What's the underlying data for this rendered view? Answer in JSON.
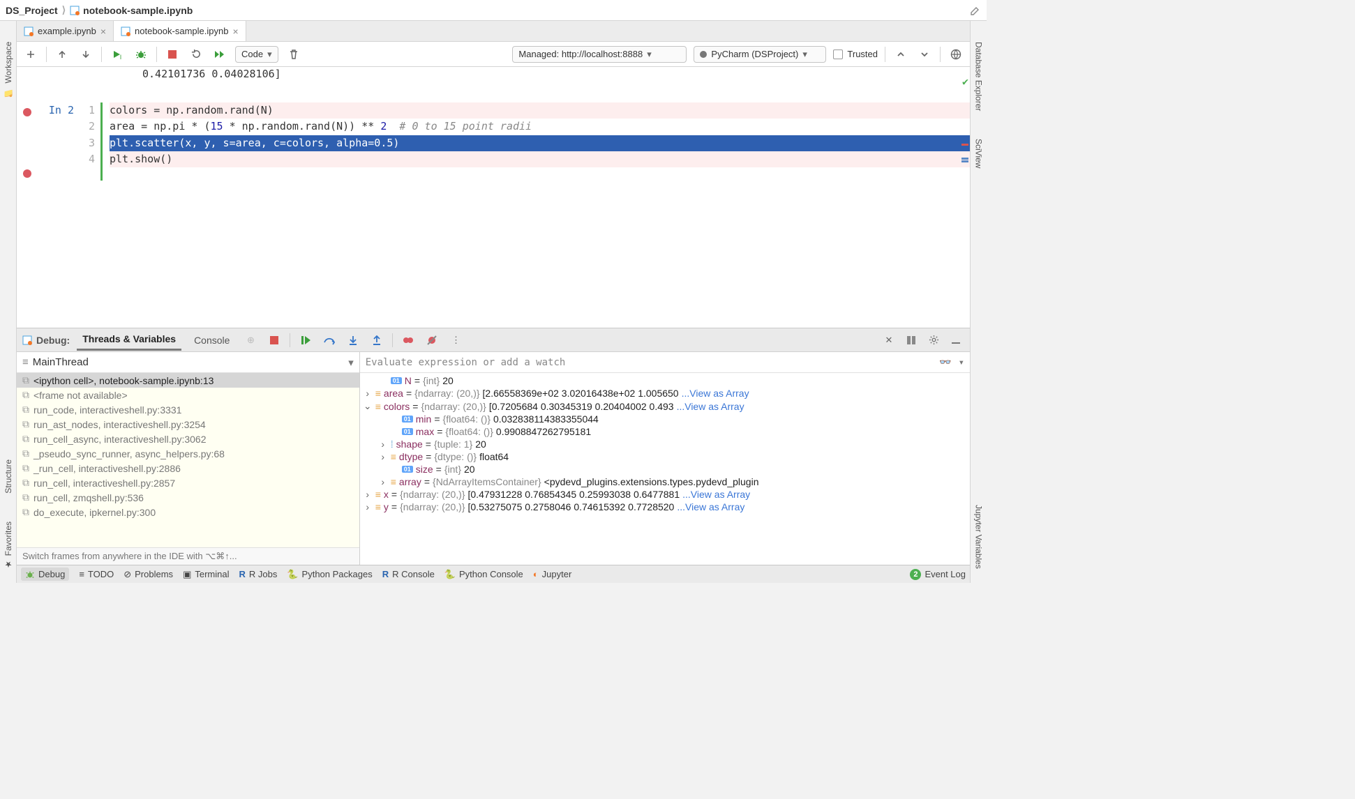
{
  "breadcrumb": {
    "project": "DS_Project",
    "file": "notebook-sample.ipynb"
  },
  "editActionTooltip": "Edit",
  "tabs": [
    {
      "name": "example.ipynb",
      "active": false
    },
    {
      "name": "notebook-sample.ipynb",
      "active": true
    }
  ],
  "sideLeft": [
    "Workspace",
    "Structure",
    "Favorites"
  ],
  "sideRight": [
    "Database Explorer",
    "SciView",
    "Jupyter Variables"
  ],
  "nbToolbar": {
    "cellType": "Code",
    "server": "Managed: http://localhost:8888",
    "kernel": "PyCharm (DSProject)",
    "trusted": "Trusted"
  },
  "outputFragment": "0.42101736 0.04028106]",
  "cell": {
    "prompt": "In 2",
    "lines": [
      {
        "n": "1",
        "text": "colors = np.random.rand(N)",
        "hl": true
      },
      {
        "n": "2",
        "text_pre": "area = np.pi * (",
        "num1": "15",
        "mid": " * np.random.rand(N)) ** ",
        "num2": "2",
        "comment": "  # 0 to 15 point radii"
      },
      {
        "n": "3",
        "text": "plt.scatter(x, y, s=area, c=colors, alpha=0.5)",
        "sel": true,
        "cursor": true
      },
      {
        "n": "4",
        "text": "plt.show()",
        "hl": true
      }
    ]
  },
  "debug": {
    "title": "Debug:",
    "tabs": {
      "threads": "Threads & Variables",
      "console": "Console"
    },
    "thread": "MainThread",
    "evalPlaceholder": "Evaluate expression or add a watch",
    "frames": [
      "<ipython cell>, notebook-sample.ipynb:13",
      "<frame not available>",
      "run_code, interactiveshell.py:3331",
      "run_ast_nodes, interactiveshell.py:3254",
      "run_cell_async, interactiveshell.py:3062",
      "_pseudo_sync_runner, async_helpers.py:68",
      "_run_cell, interactiveshell.py:2886",
      "run_cell, interactiveshell.py:2857",
      "run_cell, zmqshell.py:536",
      "do_execute, ipkernel.py:300"
    ],
    "hint": "Switch frames from anywhere in the IDE with ⌥⌘↑...",
    "vars": {
      "N": {
        "type": "{int}",
        "value": "20"
      },
      "area": {
        "type": "{ndarray: (20,)}",
        "value": "[2.66558369e+02 3.02016438e+02 1.005650",
        "link": "...View as Array"
      },
      "colors": {
        "type": "{ndarray: (20,)}",
        "value": "[0.7205684  0.30345319 0.20404002 0.493",
        "link": "...View as Array"
      },
      "min": {
        "type": "{float64: ()}",
        "value": "0.032838114383355044"
      },
      "max": {
        "type": "{float64: ()}",
        "value": "0.9908847262795181"
      },
      "shape": {
        "type": "{tuple: 1}",
        "value": "20"
      },
      "dtype": {
        "type": "{dtype: ()}",
        "value": "float64"
      },
      "size": {
        "type": "{int}",
        "value": "20"
      },
      "array": {
        "type": "{NdArrayItemsContainer}",
        "value": "<pydevd_plugins.extensions.types.pydevd_plugin"
      },
      "x": {
        "type": "{ndarray: (20,)}",
        "value": "[0.47931228 0.76854345 0.25993038 0.6477881",
        "link": "...View as Array"
      },
      "y": {
        "type": "{ndarray: (20,)}",
        "value": "[0.53275075 0.2758046  0.74615392 0.7728520",
        "link": "...View as Array"
      }
    }
  },
  "statusBar": {
    "items": [
      "Debug",
      "TODO",
      "Problems",
      "Terminal",
      "R Jobs",
      "Python Packages",
      "R Console",
      "Python Console",
      "Jupyter",
      "Event Log"
    ],
    "eventCount": "2"
  }
}
